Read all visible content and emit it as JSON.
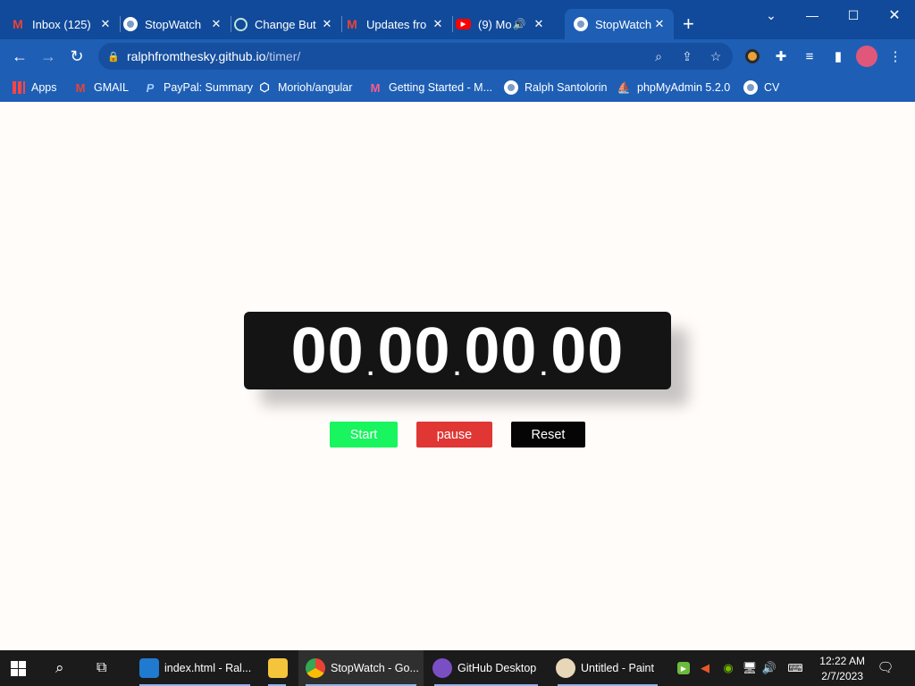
{
  "browser": {
    "tabs": [
      {
        "title": "Inbox (125)",
        "icon": "gmail-icon"
      },
      {
        "title": "StopWatch",
        "icon": "globe-icon"
      },
      {
        "title": "Change But",
        "icon": "chatgpt-icon"
      },
      {
        "title": "Updates fro",
        "icon": "gmail-icon"
      },
      {
        "title": "(9) Mo",
        "icon": "youtube-icon"
      },
      {
        "title": "StopWatch",
        "icon": "globe-icon",
        "active": true
      }
    ],
    "close_glyph": "✕",
    "new_tab_glyph": "+",
    "url_host": "ralphfromthesky.github.io",
    "url_path": "/timer/",
    "bookmarks": [
      {
        "label": "Apps",
        "icon": "apps-grid-icon"
      },
      {
        "label": "GMAIL",
        "icon": "gmail-icon"
      },
      {
        "label": "PayPal: Summary",
        "icon": "paypal-icon"
      },
      {
        "label": "Morioh/angular",
        "icon": "morioh-icon"
      },
      {
        "label": "Getting Started - M...",
        "icon": "getting-started-icon"
      },
      {
        "label": "Ralph Santolorin",
        "icon": "globe-icon"
      },
      {
        "label": "phpMyAdmin 5.2.0",
        "icon": "phpmyadmin-icon"
      },
      {
        "label": "CV",
        "icon": "globe-icon"
      }
    ]
  },
  "stopwatch": {
    "hours": "00",
    "minutes": "00",
    "seconds": "00",
    "centiseconds": "00",
    "separator": ".",
    "start_label": "Start",
    "pause_label": "pause",
    "reset_label": "Reset"
  },
  "colors": {
    "start": "#18f55e",
    "pause": "#e03634",
    "reset": "#050505",
    "display_bg": "#141414",
    "page_bg": "#fffcfa"
  },
  "taskbar": {
    "apps": [
      {
        "label": "index.html - Ral...",
        "icon": "vscode-icon"
      },
      {
        "label": "",
        "icon": "file-explorer-icon"
      },
      {
        "label": "StopWatch - Go...",
        "icon": "chrome-icon",
        "active": true
      },
      {
        "label": "GitHub Desktop",
        "icon": "github-desktop-icon"
      },
      {
        "label": "Untitled - Paint",
        "icon": "paint-icon"
      }
    ],
    "time": "12:22 AM",
    "date": "2/7/2023"
  }
}
